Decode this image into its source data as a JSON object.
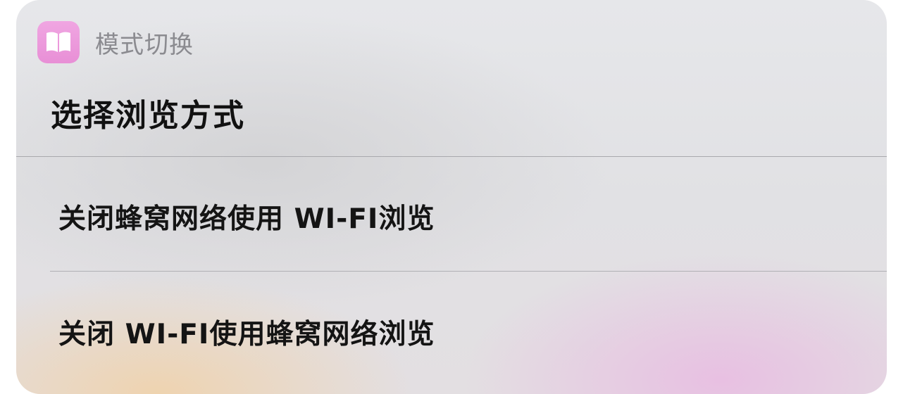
{
  "app": {
    "name": "模式切换",
    "icon": "book-icon",
    "icon_color": "#EB97DA"
  },
  "sheet": {
    "title": "选择浏览方式",
    "options": [
      {
        "label": "关闭蜂窝网络使用 WI-FI浏览"
      },
      {
        "label": "关闭 WI-FI使用蜂窝网络浏览"
      }
    ]
  }
}
